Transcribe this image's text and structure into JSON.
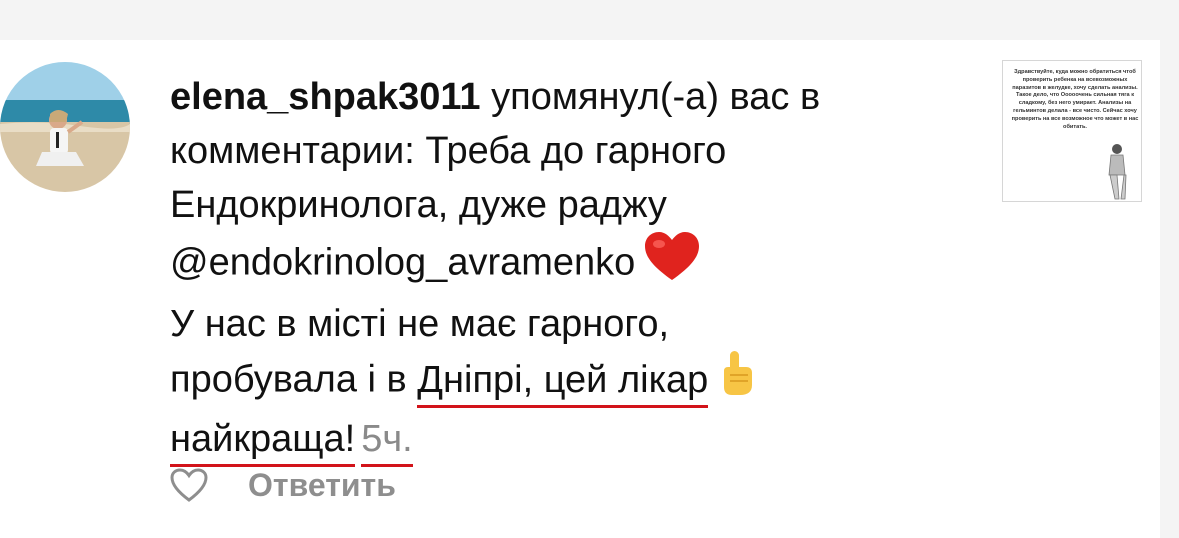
{
  "notification": {
    "username": "elena_shpak3011",
    "message_lines": [
      " упомянул(-а) вас в",
      "комментарии: Треба до гарного",
      "Ендокринолога, дуже раджу",
      "@endokrinolog_avramenko"
    ],
    "continuation_line1": "У нас в місті не має гарного,",
    "continuation_line2_plain": "пробувала і в ",
    "continuation_line2_underlined": "Дніпрі, цей лікар",
    "continuation_line3_underlined": "найкраща!",
    "timestamp": "5ч."
  },
  "icons": {
    "red_heart": "red-heart-emoji",
    "pointing_finger": "pointing-up-emoji",
    "like": "heart-outline-icon"
  },
  "actions": {
    "reply_label": "Ответить"
  },
  "thumbnail": {
    "text": "Здравствуйте, куда можно обратиться чтоб проверить ребенка на всевозможных паразитов в желудке, хочу сделать анализы. Такое дело, что Ооооочень сильная тяга к сладкому, без него умирает. Анализы на гельминтов делала - все чисто. Сейчас хочу проверить на все возможное что может в нас обитать."
  },
  "colors": {
    "underline": "#d2131a",
    "text": "#111111",
    "muted": "#8e8e8e"
  }
}
